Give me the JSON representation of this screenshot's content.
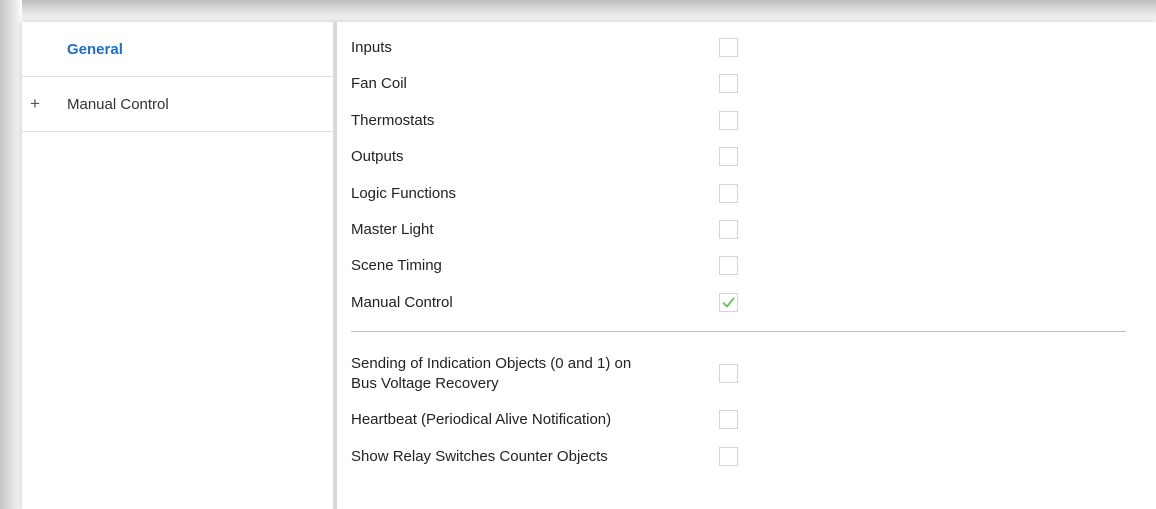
{
  "sidebar": {
    "items": [
      {
        "label": "General",
        "expander": "",
        "active": true
      },
      {
        "label": "Manual Control",
        "expander": "+",
        "active": false
      }
    ]
  },
  "options": [
    {
      "label": "Inputs",
      "checked": false
    },
    {
      "label": "Fan Coil",
      "checked": false
    },
    {
      "label": "Thermostats",
      "checked": false
    },
    {
      "label": "Outputs",
      "checked": false
    },
    {
      "label": "Logic Functions",
      "checked": false
    },
    {
      "label": "Master Light",
      "checked": false
    },
    {
      "label": "Scene Timing",
      "checked": false
    },
    {
      "label": "Manual Control",
      "checked": true
    }
  ],
  "extra_options": [
    {
      "label_line1": "Sending of Indication Objects (0 and 1) on",
      "label_line2": "Bus Voltage Recovery",
      "checked": false
    },
    {
      "label": "Heartbeat (Periodical Alive Notification)",
      "checked": false
    },
    {
      "label": "Show Relay Switches Counter Objects",
      "checked": false
    }
  ],
  "colors": {
    "accent": "#1f6fc5",
    "check_mark": "#6fbf5a",
    "border": "#d4d4d4"
  },
  "icons": {
    "check": "check-icon",
    "expand": "plus-icon"
  }
}
